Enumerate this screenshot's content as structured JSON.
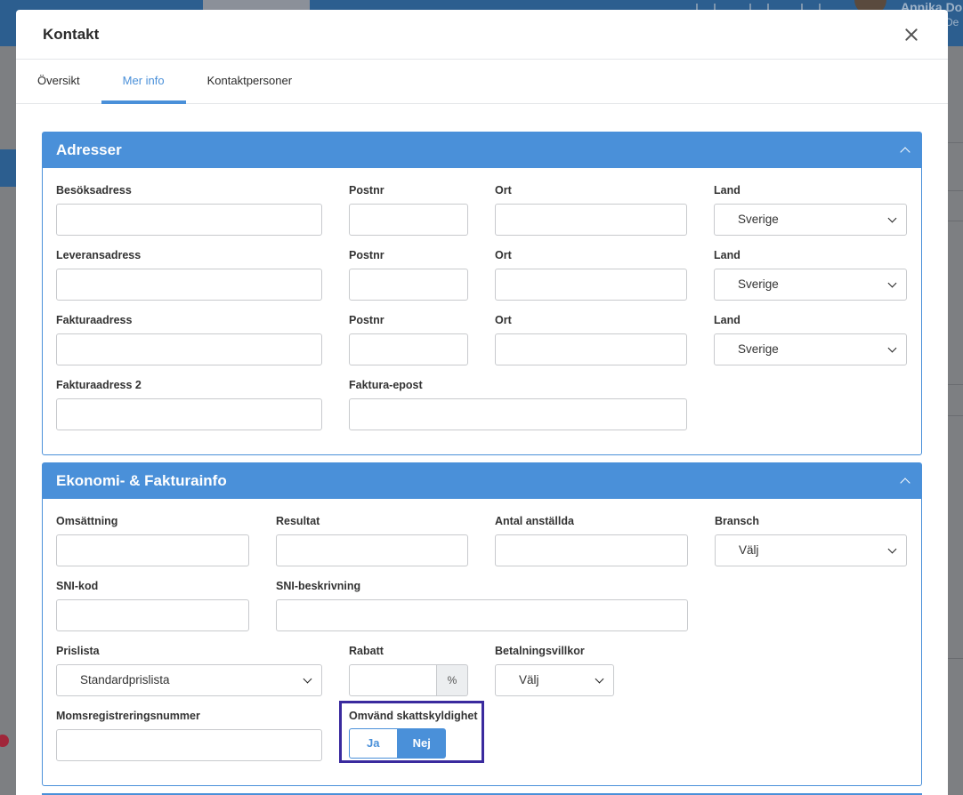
{
  "background": {
    "user_name": "Annika Do",
    "user_sub": "De"
  },
  "modal": {
    "title": "Kontakt"
  },
  "tabs": [
    {
      "label": "Översikt"
    },
    {
      "label": "Mer info"
    },
    {
      "label": "Kontaktpersoner"
    }
  ],
  "active_tab": "Mer info",
  "addresses": {
    "title": "Adresser",
    "visit": {
      "label": "Besöksadress",
      "value": ""
    },
    "visit_postnr": {
      "label": "Postnr",
      "value": ""
    },
    "visit_ort": {
      "label": "Ort",
      "value": ""
    },
    "visit_land": {
      "label": "Land",
      "value": "Sverige"
    },
    "delivery": {
      "label": "Leveransadress",
      "value": ""
    },
    "delivery_postnr": {
      "label": "Postnr",
      "value": ""
    },
    "delivery_ort": {
      "label": "Ort",
      "value": ""
    },
    "delivery_land": {
      "label": "Land",
      "value": "Sverige"
    },
    "invoice": {
      "label": "Fakturaadress",
      "value": ""
    },
    "invoice_postnr": {
      "label": "Postnr",
      "value": ""
    },
    "invoice_ort": {
      "label": "Ort",
      "value": ""
    },
    "invoice_land": {
      "label": "Land",
      "value": "Sverige"
    },
    "invoice2": {
      "label": "Fakturaadress 2",
      "value": ""
    },
    "invoice_email": {
      "label": "Faktura-epost",
      "value": ""
    }
  },
  "economy": {
    "title": "Ekonomi- & Fakturainfo",
    "turnover": {
      "label": "Omsättning",
      "value": ""
    },
    "result": {
      "label": "Resultat",
      "value": ""
    },
    "employees": {
      "label": "Antal anställda",
      "value": ""
    },
    "industry": {
      "label": "Bransch",
      "value": "Välj"
    },
    "sni_code": {
      "label": "SNI-kod",
      "value": ""
    },
    "sni_desc": {
      "label": "SNI-beskrivning",
      "value": ""
    },
    "pricelist": {
      "label": "Prislista",
      "value": "Standardprislista"
    },
    "discount": {
      "label": "Rabatt",
      "value": "",
      "unit": "%"
    },
    "payment_terms": {
      "label": "Betalningsvillkor",
      "value": "Välj"
    },
    "vat_number": {
      "label": "Momsregistreringsnummer",
      "value": ""
    },
    "reverse_charge": {
      "label": "Omvänd skattskyldighet",
      "yes": "Ja",
      "no": "Nej",
      "selected": "Nej"
    }
  },
  "colors": {
    "accent": "#4a90d9",
    "highlight": "#3a2a9e"
  }
}
